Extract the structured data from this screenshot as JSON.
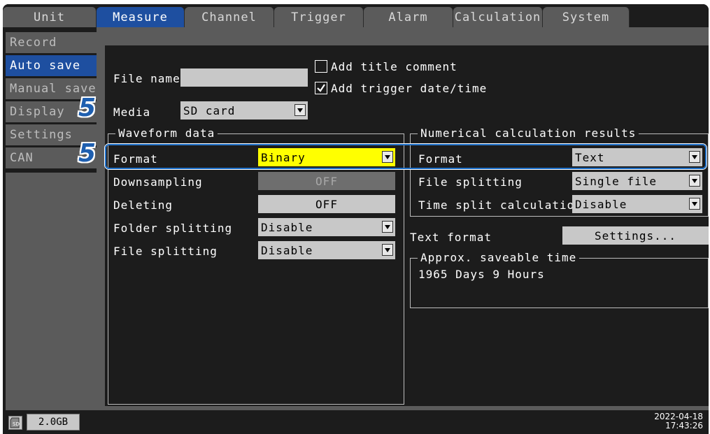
{
  "tabs": [
    "Unit",
    "Measure",
    "Channel",
    "Trigger",
    "Alarm",
    "Calculation",
    "System"
  ],
  "sidebar": [
    "Record",
    "Auto save",
    "Manual save",
    "Display",
    "Settings",
    "CAN"
  ],
  "file_name": {
    "label": "File name",
    "value": ""
  },
  "add_title_comment": {
    "label": "Add title comment",
    "checked": false
  },
  "add_trigger_date": {
    "label": "Add trigger date/time",
    "checked": true
  },
  "media": {
    "label": "Media",
    "value": "SD card"
  },
  "waveform": {
    "title": "Waveform data",
    "format_label": "Format",
    "format_value": "Binary",
    "downsampling_label": "Downsampling",
    "downsampling_value": "OFF",
    "deleting_label": "Deleting",
    "deleting_value": "OFF",
    "folder_label": "Folder splitting",
    "folder_value": "Disable",
    "file_label": "File splitting",
    "file_value": "Disable"
  },
  "numerical": {
    "title": "Numerical calculation results",
    "format_label": "Format",
    "format_value": "Text",
    "file_label": "File splitting",
    "file_value": "Single file",
    "time_label": "Time split calculation",
    "time_value": "Disable"
  },
  "text_format": {
    "label": "Text format",
    "button": "Settings..."
  },
  "saveable": {
    "title": "Approx. saveable time",
    "value": "1965 Days 9 Hours"
  },
  "step_markers": [
    "5",
    "5"
  ],
  "status": {
    "sd_icon": "sd-card-icon",
    "capacity": "2.0GB",
    "date": "2022-04-18",
    "time": "17:43:26"
  },
  "colors": {
    "accent": "#1e4fa0",
    "highlight": "#ffff00",
    "callout": "#1e5fb0"
  }
}
